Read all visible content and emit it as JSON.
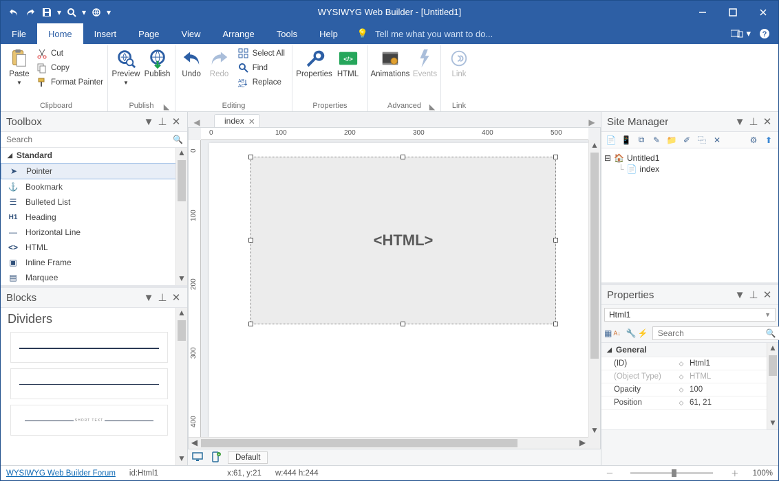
{
  "app": {
    "title": "WYSIWYG Web Builder - [Untitled1]"
  },
  "menu": {
    "items": [
      "File",
      "Home",
      "Insert",
      "Page",
      "View",
      "Arrange",
      "Tools",
      "Help"
    ],
    "active_index": 1,
    "tellme": "Tell me what you want to do..."
  },
  "ribbon": {
    "clipboard": {
      "label": "Clipboard",
      "paste": "Paste",
      "cut": "Cut",
      "copy": "Copy",
      "format": "Format Painter"
    },
    "publish": {
      "label": "Publish",
      "preview": "Preview",
      "publish": "Publish"
    },
    "editing": {
      "label": "Editing",
      "undo": "Undo",
      "redo": "Redo",
      "select_all": "Select All",
      "find": "Find",
      "replace": "Replace"
    },
    "properties": {
      "label": "Properties",
      "props": "Properties",
      "html": "HTML"
    },
    "advanced": {
      "label": "Advanced",
      "anim": "Animations",
      "events": "Events"
    },
    "link": {
      "label": "Link",
      "link": "Link"
    }
  },
  "toolbox": {
    "title": "Toolbox",
    "search_ph": "Search",
    "category": "Standard",
    "items": [
      "Pointer",
      "Bookmark",
      "Bulleted List",
      "Heading",
      "Horizontal Line",
      "HTML",
      "Inline Frame",
      "Marquee"
    ]
  },
  "blocks": {
    "title": "Blocks",
    "section": "Dividers",
    "card_text": "SHORT TEXT"
  },
  "tabs": {
    "active": "index"
  },
  "canvas": {
    "object_label": "<HTML>",
    "ruler_h": [
      "0",
      "100",
      "200",
      "300",
      "400",
      "500"
    ],
    "ruler_v": [
      "0",
      "100",
      "200",
      "300",
      "400"
    ]
  },
  "viewbar": {
    "default": "Default"
  },
  "site_manager": {
    "title": "Site Manager",
    "root": "Untitled1",
    "page": "index"
  },
  "properties": {
    "title": "Properties",
    "selected": "Html1",
    "search_ph": "Search",
    "cat": "General",
    "rows": [
      {
        "k": "(ID)",
        "v": "Html1"
      },
      {
        "k": "(Object Type)",
        "v": "HTML",
        "dim": true
      },
      {
        "k": "Opacity",
        "v": "100"
      },
      {
        "k": "Position",
        "v": "61, 21",
        "dim_k": true
      }
    ]
  },
  "status": {
    "forum": "WYSIWYG Web Builder Forum",
    "id": "id:Html1",
    "xy": "x:61, y:21",
    "wh": "w:444 h:244",
    "zoom": "100%"
  }
}
